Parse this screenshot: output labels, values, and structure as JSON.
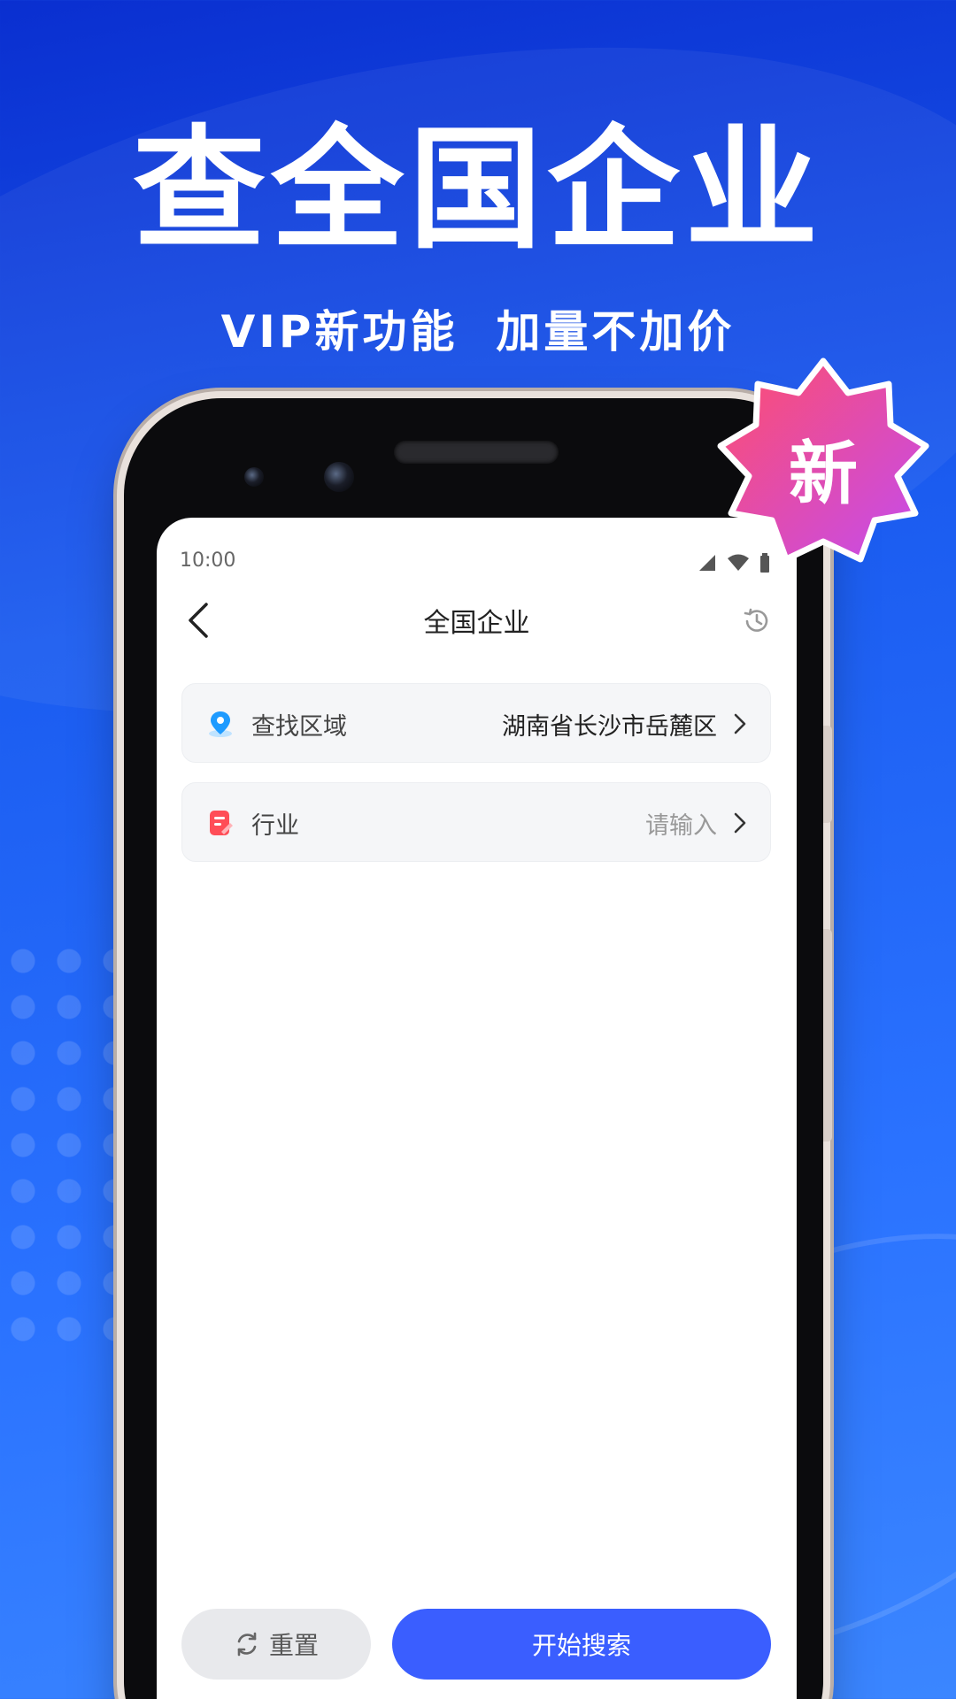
{
  "headline": "查全国企业",
  "subline": "VIP新功能  加量不加价",
  "badge": "新",
  "status_bar": {
    "time": "10:00"
  },
  "nav": {
    "title": "全国企业"
  },
  "fields": [
    {
      "label": "查找区域",
      "value": "湖南省长沙市岳麓区",
      "icon": "location-pin-icon"
    },
    {
      "label": "行业",
      "value": "请输入",
      "icon": "industry-note-icon"
    }
  ],
  "actions": {
    "reset_label": "重置",
    "search_label": "开始搜索"
  },
  "colors": {
    "background": "#1b5cf0",
    "primary_button": "#3a5eff",
    "badge_gradient_start": "#ff4d6d",
    "badge_gradient_end": "#c34cf0"
  }
}
